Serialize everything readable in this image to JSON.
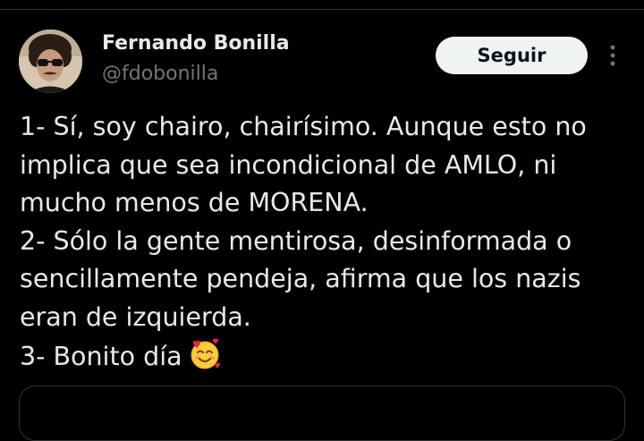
{
  "author": {
    "display_name": "Fernando Bonilla",
    "handle": "@fdobonilla",
    "avatar_icon": "profile-photo"
  },
  "actions": {
    "follow_label": "Seguir",
    "more_icon": "more-vertical-icon"
  },
  "tweet": {
    "lines": [
      "1- Sí, soy chairo, chairísimo. Aunque esto no",
      "implica que sea incondicional de AMLO, ni",
      "mucho menos de MORENA.",
      "2- Sólo la gente mentirosa, desinformada o",
      "sencillamente pendeja, afirma que los nazis",
      "eran de izquierda.",
      "3- Bonito día"
    ],
    "emoji": "smiling-face-with-hearts-emoji"
  },
  "colors": {
    "background": "#000000",
    "text_primary": "#e7e9ea",
    "text_secondary": "#71767b",
    "follow_button_bg": "#eff3f4",
    "follow_button_text": "#0f1419",
    "divider": "#2f3336"
  }
}
